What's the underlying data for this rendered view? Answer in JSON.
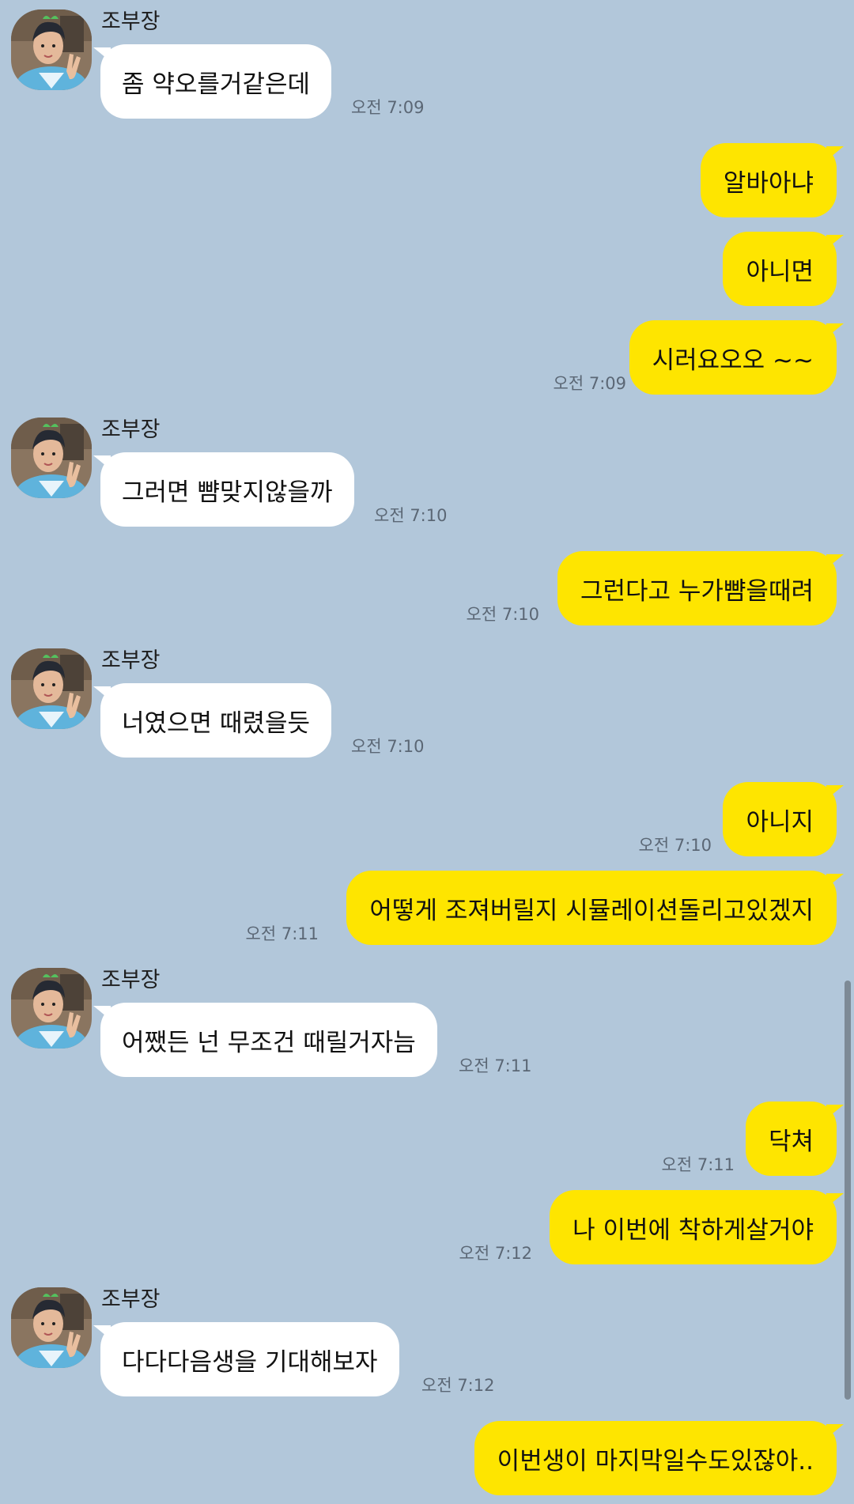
{
  "chat": {
    "sender_name": "조부장",
    "messages": [
      {
        "text": "좀 약오를거같은데",
        "time": "오전 7:09"
      },
      {
        "text": "알바아냐"
      },
      {
        "text": "아니면"
      },
      {
        "text": "시러요오오 ~~",
        "time": "오전 7:09"
      },
      {
        "text": "그러면 뺨맞지않을까",
        "time": "오전 7:10"
      },
      {
        "text": "그런다고 누가뺨을때려",
        "time": "오전 7:10"
      },
      {
        "text": "너였으면 때렸을듯",
        "time": "오전 7:10"
      },
      {
        "text": "아니지",
        "time": "오전 7:10"
      },
      {
        "text": "어떻게 조져버릴지 시뮬레이션돌리고있겠지",
        "time": "오전 7:11"
      },
      {
        "text": "어쨌든 넌 무조건 때릴거자늠",
        "time": "오전 7:11"
      },
      {
        "text": "닥쳐",
        "time": "오전 7:11"
      },
      {
        "text": "나 이번에 착하게살거야",
        "time": "오전 7:12"
      },
      {
        "text": "다다다음생을 기대해보자",
        "time": "오전 7:12"
      },
      {
        "text": "이번생이 마지막일수도있잖아.."
      }
    ]
  },
  "colors": {
    "background": "#b2c7da",
    "incoming_bubble": "#ffffff",
    "outgoing_bubble": "#fee500",
    "timestamp": "#5b6775"
  },
  "icons": {
    "avatar": "profile-photo"
  }
}
